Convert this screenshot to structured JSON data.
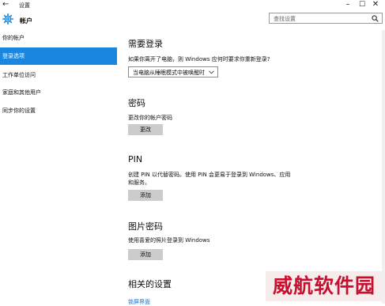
{
  "window": {
    "title": "设置",
    "back_icon": "back-arrow-icon",
    "controls": [
      "minimize-icon",
      "maximize-icon",
      "close-icon"
    ]
  },
  "header": {
    "app_title": "帐户",
    "icon": "gear-icon",
    "search_placeholder": "查找设置"
  },
  "sidebar": {
    "items": [
      {
        "label": "你的帐户"
      },
      {
        "label": "登录选项"
      },
      {
        "label": "工作单位访问"
      },
      {
        "label": "家庭和其他用户"
      },
      {
        "label": "同步你的设置"
      }
    ],
    "active_index": 1
  },
  "main": {
    "require_signin": {
      "heading": "需要登录",
      "question": "如果你离开了电脑，则 Windows 应何时要求你重新登录?",
      "dropdown_value": "当电脑从睡眠模式中被唤醒时"
    },
    "password": {
      "heading": "密码",
      "desc": "更改你的帐户密码",
      "button": "更改"
    },
    "pin": {
      "heading": "PIN",
      "desc_line1": "创建 PIN 以代替密码。使用 PIN 会更易于登录到 Windows、应用",
      "desc_line2": "和服务。",
      "button": "添加"
    },
    "picture_password": {
      "heading": "图片密码",
      "desc": "使用喜爱的照片登录到 Windows",
      "button": "添加"
    },
    "related": {
      "heading": "相关的设置",
      "link": "锁屏界面"
    }
  },
  "watermark": {
    "text": "威航软件园"
  },
  "colors": {
    "accent": "#1a86e0",
    "button": "#cccccc",
    "link": "#1a6fd0",
    "watermark": "#c8102e"
  }
}
